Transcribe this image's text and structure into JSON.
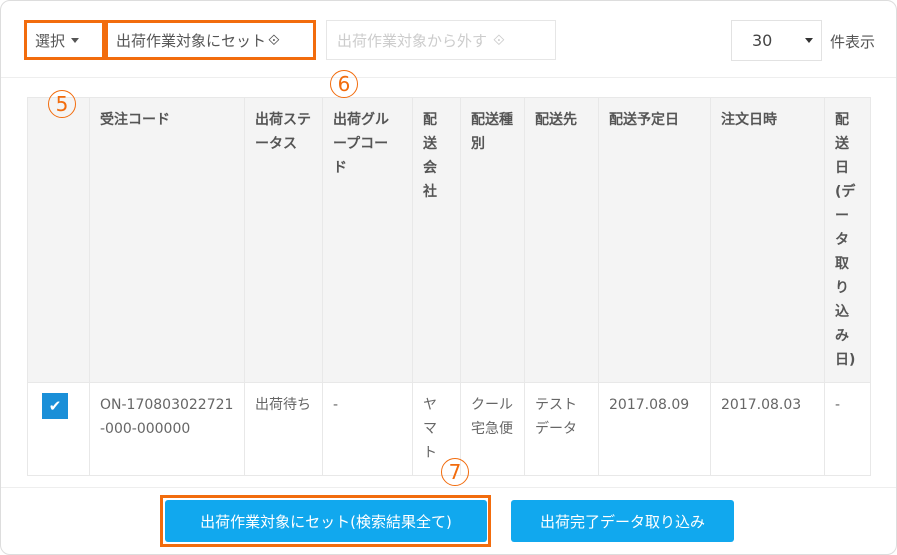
{
  "toolbar": {
    "select_label": "選択",
    "set_label": "出荷作業対象にセット",
    "remove_label": "出荷作業対象から外す",
    "page_size": "30",
    "per_page_label": "件表示"
  },
  "annotations": {
    "a5": "5",
    "a6": "6",
    "a7": "7"
  },
  "table": {
    "headers": [
      "受注コード",
      "出荷ステータス",
      "出荷グループコード",
      "配送会社",
      "配送種別",
      "配送先",
      "配送予定日",
      "注文日時",
      "配送日(データ取り込み日)"
    ],
    "rows": [
      {
        "checked": true,
        "cells": [
          "ON-170803022721-000-000000",
          "出荷待ち",
          "-",
          "ヤマト",
          "クール宅急便",
          "テストデータ",
          "2017.08.09",
          "2017.08.03",
          "-"
        ]
      }
    ]
  },
  "footer": {
    "set_all_label": "出荷作業対象にセット(検索結果全て)",
    "import_label": "出荷完了データ取り込み"
  },
  "colors": {
    "accent": "#11a8ee",
    "highlight": "#f26c0d"
  }
}
